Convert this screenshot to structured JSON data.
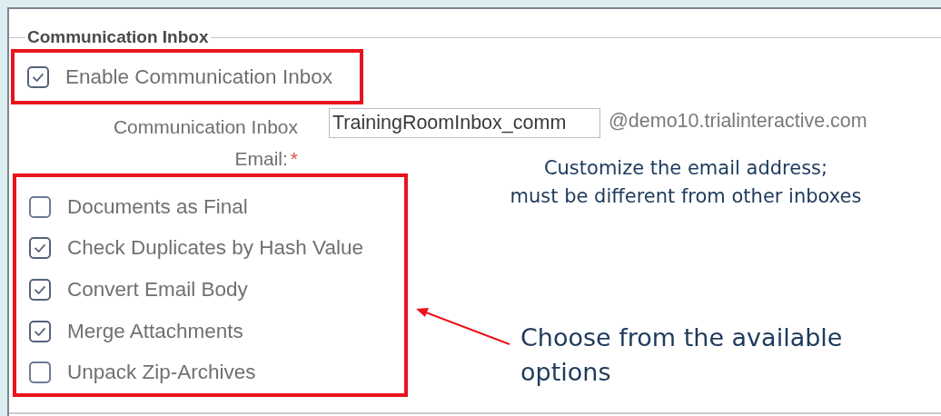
{
  "section": {
    "title": "Communication Inbox"
  },
  "enable": {
    "label": "Enable Communication Inbox",
    "checked": true
  },
  "email": {
    "label_lines": [
      "Communication Inbox",
      "Email:"
    ],
    "required_mark": "*",
    "value": "TrainingRoomInbox_comm",
    "domain": "@demo10.trialinteractive.com"
  },
  "options": [
    {
      "label": "Documents as Final",
      "checked": false
    },
    {
      "label": "Check Duplicates by Hash Value",
      "checked": true
    },
    {
      "label": "Convert Email Body",
      "checked": true
    },
    {
      "label": "Merge Attachments",
      "checked": true
    },
    {
      "label": "Unpack Zip-Archives",
      "checked": false
    }
  ],
  "email_note": {
    "lines": [
      "Customize the email address;",
      "must be different from other inboxes"
    ]
  },
  "options_note": {
    "lines": [
      "Choose from the available",
      "options"
    ]
  }
}
